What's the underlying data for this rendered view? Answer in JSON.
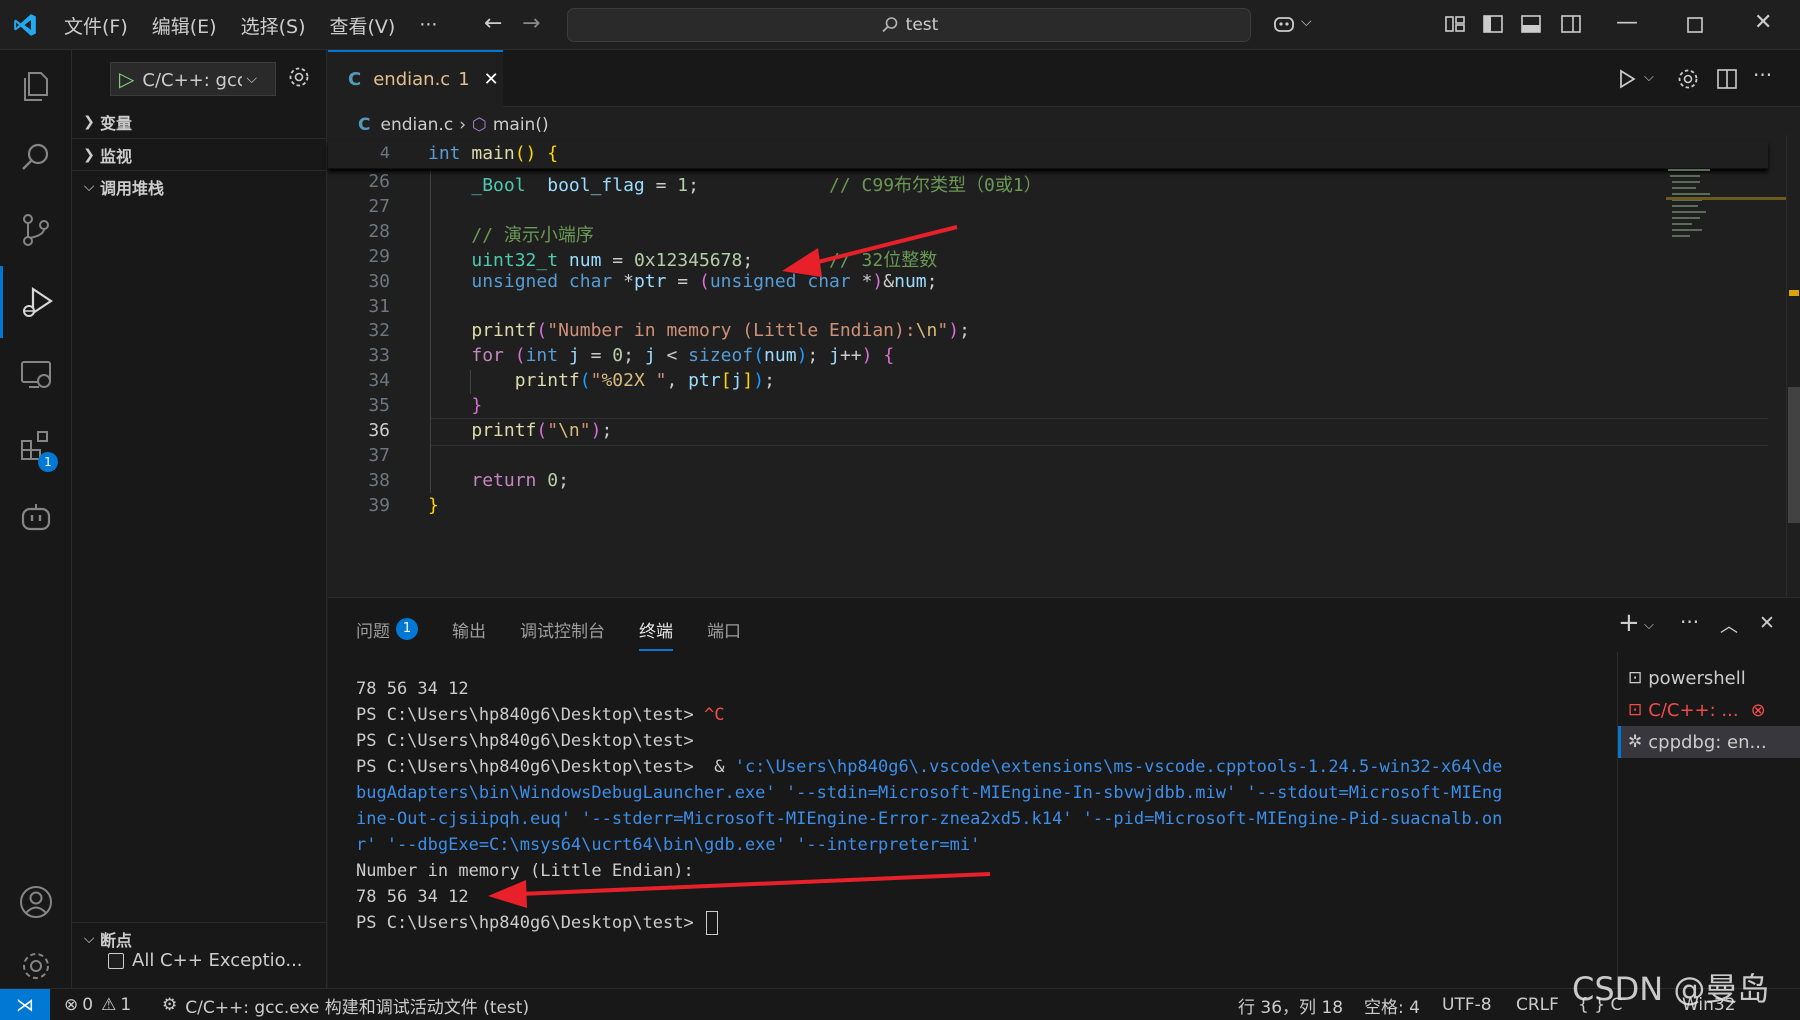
{
  "titlebar": {
    "menus": [
      "文件(F)",
      "编辑(E)",
      "选择(S)",
      "查看(V)",
      "···"
    ],
    "search": "test"
  },
  "activity": {
    "extensions_badge": "1"
  },
  "sidebar": {
    "debug_config": "C/C++: gcc.exe 构建和调试活动文件",
    "sections": {
      "variables": "变量",
      "watch": "监视",
      "callstack": "调用堆栈",
      "breakpoints": "断点"
    },
    "breakpoint_item": "All C++ Exceptio..."
  },
  "editor": {
    "tab": {
      "icon": "C",
      "filename": "endian.c",
      "count": "1"
    },
    "breadcrumb": {
      "icon": "C",
      "file": "endian.c",
      "symbol": "main()"
    },
    "sticky": {
      "line": "4",
      "code": [
        "int",
        " ",
        "main",
        "() {"
      ]
    },
    "lines": [
      {
        "n": "26",
        "parts": [
          [
            "ty",
            "_Bool"
          ],
          [
            "",
            "  "
          ],
          [
            "var",
            "bool_flag"
          ],
          [
            "",
            " = "
          ],
          [
            "num",
            "1"
          ],
          [
            "",
            ";            "
          ],
          [
            "cmt",
            "// C99布尔类型（0或1）"
          ]
        ]
      },
      {
        "n": "27",
        "parts": []
      },
      {
        "n": "28",
        "parts": [
          [
            "cmt",
            "// 演示小端序"
          ]
        ]
      },
      {
        "n": "29",
        "parts": [
          [
            "ty",
            "uint32_t"
          ],
          [
            "",
            " "
          ],
          [
            "var",
            "num"
          ],
          [
            "",
            " = "
          ],
          [
            "num",
            "0x12345678"
          ],
          [
            "",
            ";       "
          ],
          [
            "cmt",
            "// 32位整数"
          ]
        ]
      },
      {
        "n": "30",
        "parts": [
          [
            "kw",
            "unsigned"
          ],
          [
            "",
            " "
          ],
          [
            "kw",
            "char"
          ],
          [
            "",
            " *"
          ],
          [
            "var",
            "ptr"
          ],
          [
            "",
            " = "
          ],
          [
            "br2",
            "("
          ],
          [
            "kw",
            "unsigned"
          ],
          [
            "",
            " "
          ],
          [
            "kw",
            "char"
          ],
          [
            "",
            " *"
          ],
          [
            "br2",
            ")"
          ],
          [
            "",
            "&"
          ],
          [
            "var",
            "num"
          ],
          [
            "",
            ";"
          ]
        ]
      },
      {
        "n": "31",
        "parts": []
      },
      {
        "n": "32",
        "parts": [
          [
            "fn",
            "printf"
          ],
          [
            "br2",
            "("
          ],
          [
            "str",
            "\"Number in memory (Little Endian):"
          ],
          [
            "esc",
            "\\n"
          ],
          [
            "str",
            "\""
          ],
          [
            "br2",
            ")"
          ],
          [
            "",
            ";"
          ]
        ]
      },
      {
        "n": "33",
        "parts": [
          [
            "ctl",
            "for"
          ],
          [
            "",
            " "
          ],
          [
            "br2",
            "("
          ],
          [
            "kw",
            "int"
          ],
          [
            "",
            " "
          ],
          [
            "var",
            "j"
          ],
          [
            "",
            " = "
          ],
          [
            "num",
            "0"
          ],
          [
            "",
            "; "
          ],
          [
            "var",
            "j"
          ],
          [
            "",
            " < "
          ],
          [
            "kw",
            "sizeof"
          ],
          [
            "br3",
            "("
          ],
          [
            "var",
            "num"
          ],
          [
            "br3",
            ")"
          ],
          [
            "",
            "; "
          ],
          [
            "var",
            "j"
          ],
          [
            "",
            "++"
          ],
          [
            "br2",
            ")"
          ],
          [
            "",
            " "
          ],
          [
            "br2",
            "{"
          ]
        ]
      },
      {
        "n": "34",
        "parts": [
          [
            "",
            "    "
          ],
          [
            "fn",
            "printf"
          ],
          [
            "br3",
            "("
          ],
          [
            "str",
            "\""
          ],
          [
            "esc",
            "%02X"
          ],
          [
            "str",
            " \""
          ],
          [
            "",
            ", "
          ],
          [
            "var",
            "ptr"
          ],
          [
            "br1",
            "["
          ],
          [
            "var",
            "j"
          ],
          [
            "br1",
            "]"
          ],
          [
            "br3",
            ")"
          ],
          [
            "",
            ";"
          ]
        ]
      },
      {
        "n": "35",
        "parts": [
          [
            "br2",
            "}"
          ]
        ]
      },
      {
        "n": "36",
        "parts": [
          [
            "fn",
            "printf"
          ],
          [
            "br2",
            "("
          ],
          [
            "str",
            "\""
          ],
          [
            "esc",
            "\\n"
          ],
          [
            "str",
            "\""
          ],
          [
            "br2",
            ")"
          ],
          [
            "",
            ";"
          ]
        ]
      },
      {
        "n": "37",
        "parts": []
      },
      {
        "n": "38",
        "parts": [
          [
            "ctl",
            "return"
          ],
          [
            "",
            " "
          ],
          [
            "num",
            "0"
          ],
          [
            "",
            ";"
          ]
        ]
      },
      {
        "n": "39",
        "parts": [
          [
            "br1",
            "}"
          ]
        ]
      }
    ],
    "current_line": "36"
  },
  "panel": {
    "tabs": [
      "问题",
      "输出",
      "调试控制台",
      "终端",
      "端口"
    ],
    "problems_badge": "1",
    "active_tab": "终端",
    "terminal_lines": [
      [
        [
          "",
          "78 56 34 12"
        ]
      ],
      [
        [
          "",
          "PS C:\\Users\\hp840g6\\Desktop\\test> "
        ],
        [
          "t-red",
          "^C"
        ]
      ],
      [
        [
          "",
          "PS C:\\Users\\hp840g6\\Desktop\\test>"
        ]
      ],
      [
        [
          "",
          "PS C:\\Users\\hp840g6\\Desktop\\test>  & "
        ],
        [
          "t-blue",
          "'c:\\Users\\hp840g6\\.vscode\\extensions\\ms-vscode.cpptools-1.24.5-win32-x64\\de"
        ]
      ],
      [
        [
          "t-blue",
          "bugAdapters\\bin\\WindowsDebugLauncher.exe' '--stdin=Microsoft-MIEngine-In-sbvwjdbb.miw' '--stdout=Microsoft-MIEng"
        ]
      ],
      [
        [
          "t-blue",
          "ine-Out-cjsiipqh.euq' '--stderr=Microsoft-MIEngine-Error-znea2xd5.k14' '--pid=Microsoft-MIEngine-Pid-suacnalb.on"
        ]
      ],
      [
        [
          "t-blue",
          "r' '--dbgExe=C:\\msys64\\ucrt64\\bin\\gdb.exe' '--interpreter=mi'"
        ]
      ],
      [
        [
          "",
          "Number in memory (Little Endian):"
        ]
      ],
      [
        [
          "",
          "78 56 34 12"
        ]
      ],
      [
        [
          "",
          "PS C:\\Users\\hp840g6\\Desktop\\test> "
        ]
      ]
    ],
    "terminals": [
      "powershell",
      "C/C++: ...",
      "cppdbg: en..."
    ]
  },
  "statusbar": {
    "errors": "0",
    "warnings": "1",
    "debug_target": "C/C++: gcc.exe 构建和调试活动文件 (test)",
    "position": "行 36，列 18",
    "spaces": "空格: 4",
    "encoding": "UTF-8",
    "eol": "CRLF",
    "language": "{ } C",
    "platform": "Win32"
  },
  "watermark": "CSDN @曼岛",
  "colors": {
    "accent": "#0078d4",
    "annotation_arrow": "#e8202a",
    "error": "#f14c4c"
  }
}
